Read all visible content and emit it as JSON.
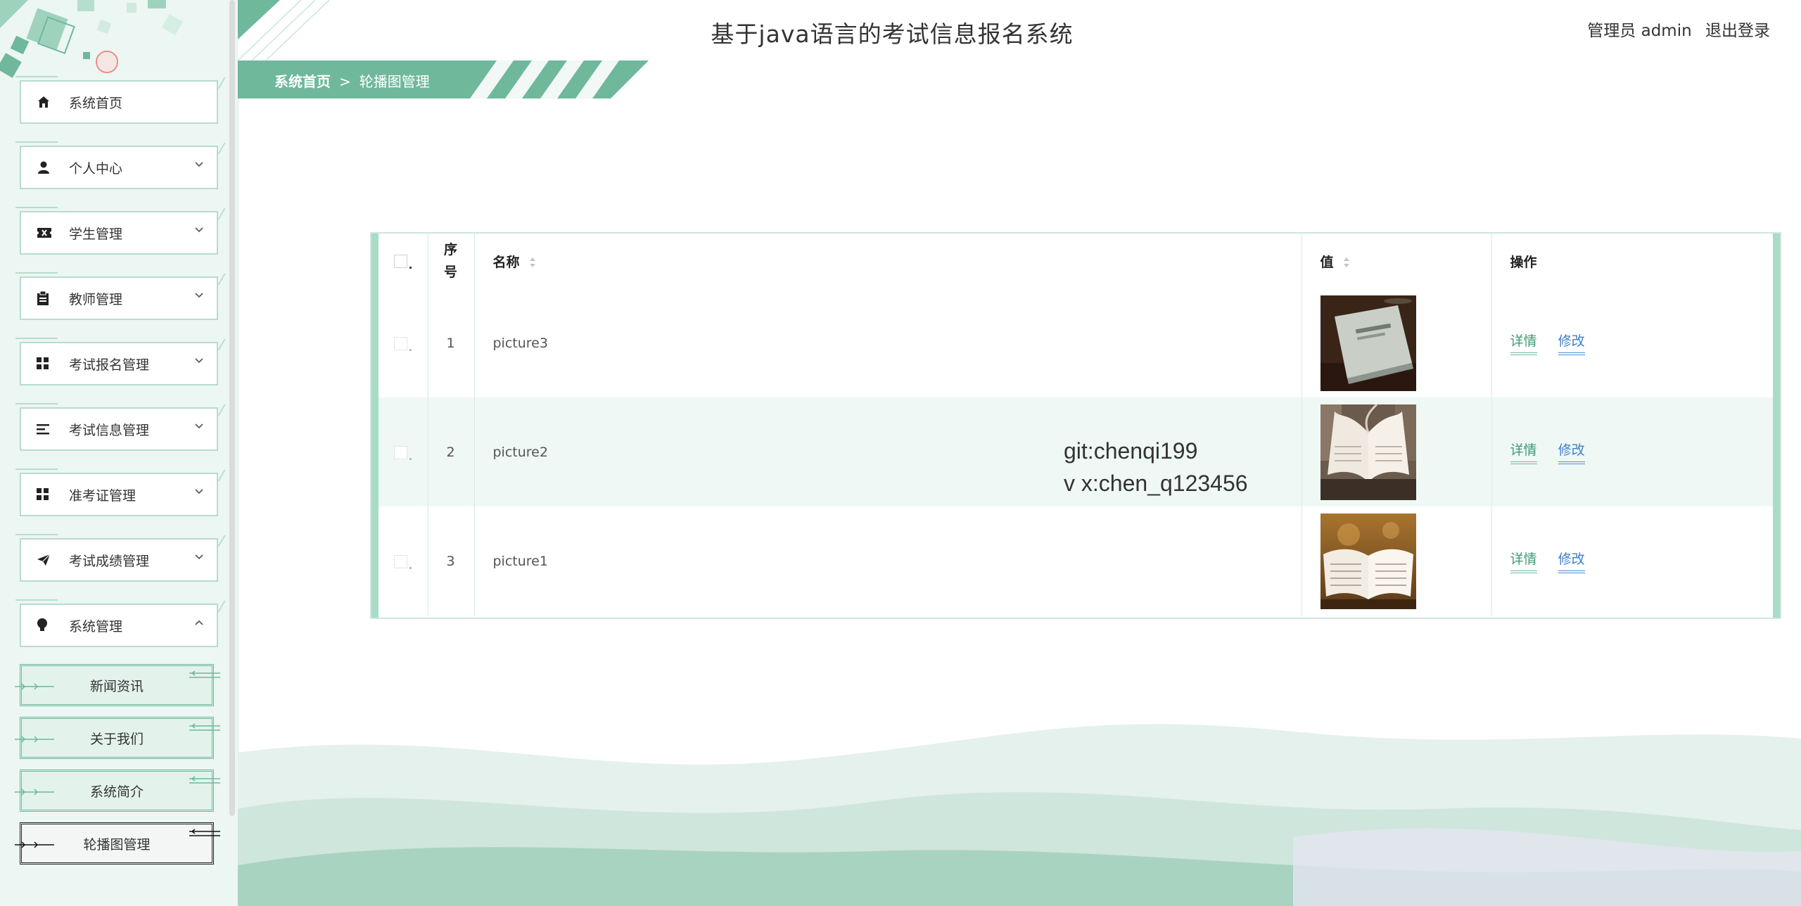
{
  "header": {
    "title": "基于java语言的考试信息报名系统",
    "user_label": "管理员 admin",
    "logout_label": "退出登录"
  },
  "breadcrumb": {
    "home": "系统首页",
    "separator": ">",
    "current": "轮播图管理"
  },
  "sidebar": {
    "items": [
      {
        "label": "系统首页",
        "icon": "home-icon"
      },
      {
        "label": "个人中心",
        "icon": "person-icon"
      },
      {
        "label": "学生管理",
        "icon": "ticket-icon"
      },
      {
        "label": "教师管理",
        "icon": "clipboard-icon"
      },
      {
        "label": "考试报名管理",
        "icon": "grid-icon"
      },
      {
        "label": "考试信息管理",
        "icon": "list-icon"
      },
      {
        "label": "准考证管理",
        "icon": "grid-icon"
      },
      {
        "label": "考试成绩管理",
        "icon": "send-icon"
      },
      {
        "label": "系统管理",
        "icon": "bulb-icon"
      }
    ],
    "sub_items": [
      {
        "label": "新闻资讯"
      },
      {
        "label": "关于我们"
      },
      {
        "label": "系统简介"
      },
      {
        "label": "轮播图管理",
        "active": true
      }
    ]
  },
  "table": {
    "headers": {
      "index": "序号",
      "name": "名称",
      "value": "值",
      "actions": "操作"
    },
    "rows": [
      {
        "index": "1",
        "name": "picture3",
        "image": "closed-book-on-table"
      },
      {
        "index": "2",
        "name": "picture2",
        "image": "open-book-pages-flipping"
      },
      {
        "index": "3",
        "name": "picture1",
        "image": "open-book-warm-background"
      }
    ],
    "detail_label": "详情",
    "edit_label": "修改"
  },
  "watermark": {
    "line1": "git:chenqi199",
    "line2": "v x:chen_q123456"
  },
  "colors": {
    "accent": "#6fb89c",
    "accent_dark": "#3e9a74",
    "link_blue": "#3f7fc8",
    "sidebar_bg": "#ecf6f2"
  }
}
